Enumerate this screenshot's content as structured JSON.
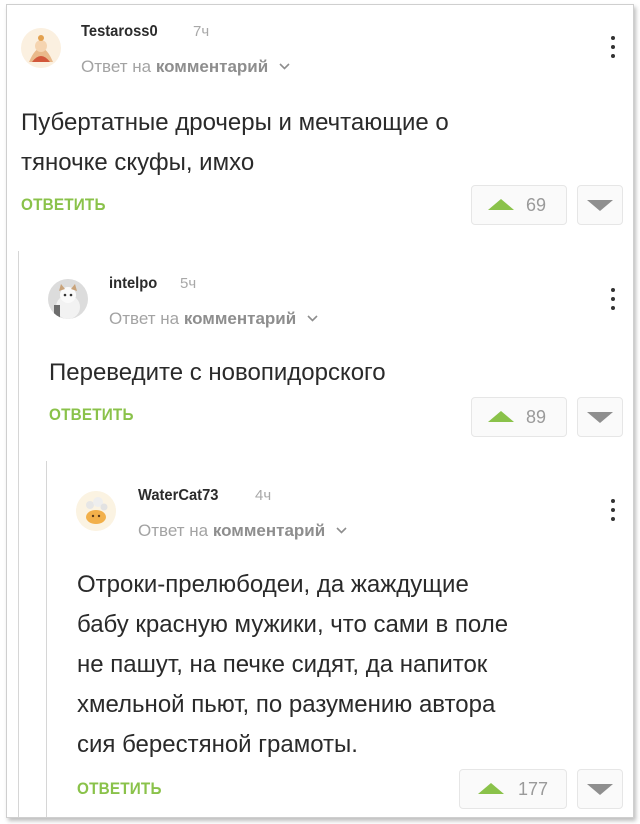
{
  "comments": [
    {
      "username": "Testaross0",
      "time": "7ч",
      "reply_prefix": "Ответ на",
      "reply_target": "комментарий",
      "text_lines": [
        "Пубертатные дрочеры и мечтающие о",
        "тяночке скуфы, имхо"
      ],
      "reply_label": "ОТВЕТИТЬ",
      "rating": "69"
    },
    {
      "username": "intelpo",
      "time": "5ч",
      "reply_prefix": "Ответ на",
      "reply_target": "комментарий",
      "text_lines": [
        "Переведите с новопидорского"
      ],
      "reply_label": "ОТВЕТИТЬ",
      "rating": "89"
    },
    {
      "username": "WaterCat73",
      "time": "4ч",
      "reply_prefix": "Ответ на",
      "reply_target": "комментарий",
      "text_lines": [
        "Отроки-прелюбодеи, да жаждущие",
        "бабу красную мужики, что сами в поле",
        "не пашут, на печке сидят, да напиток",
        "хмельной пьют, по разумению автора",
        "сия берестяной грамоты."
      ],
      "reply_label": "ОТВЕТИТЬ",
      "rating": "177"
    }
  ],
  "colors": {
    "accent_green": "#8ac24a",
    "muted_text": "#a3a3a3"
  },
  "icons": {
    "upvote": "triangle-up-icon",
    "downvote": "triangle-down-icon",
    "more": "vertical-dots-icon",
    "expand": "chevron-down-icon"
  }
}
